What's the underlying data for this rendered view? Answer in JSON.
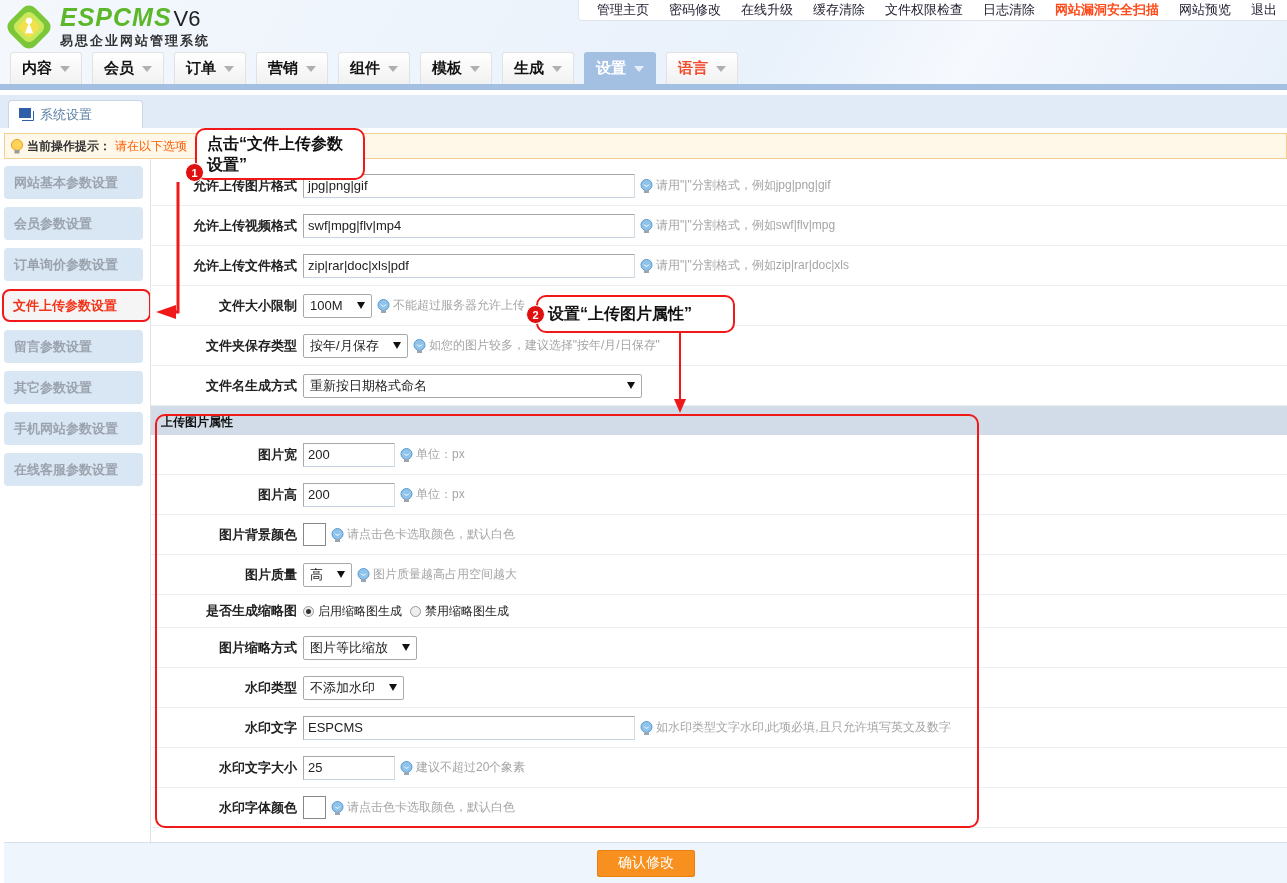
{
  "logo": {
    "brand": "ESPCMS",
    "version": "V6",
    "subtitle": "易思企业网站管理系统"
  },
  "top_links": [
    {
      "label": "管理主页",
      "highlighted": false
    },
    {
      "label": "密码修改",
      "highlighted": false
    },
    {
      "label": "在线升级",
      "highlighted": false
    },
    {
      "label": "缓存清除",
      "highlighted": false
    },
    {
      "label": "文件权限检查",
      "highlighted": false
    },
    {
      "label": "日志清除",
      "highlighted": false
    },
    {
      "label": "网站漏洞安全扫描",
      "highlighted": true
    },
    {
      "label": "网站预览",
      "highlighted": false
    },
    {
      "label": "退出",
      "highlighted": false
    }
  ],
  "main_menu": [
    {
      "label": "内容",
      "selected": false,
      "highlighted": false
    },
    {
      "label": "会员",
      "selected": false,
      "highlighted": false
    },
    {
      "label": "订单",
      "selected": false,
      "highlighted": false
    },
    {
      "label": "营销",
      "selected": false,
      "highlighted": false
    },
    {
      "label": "组件",
      "selected": false,
      "highlighted": false
    },
    {
      "label": "模板",
      "selected": false,
      "highlighted": false
    },
    {
      "label": "生成",
      "selected": false,
      "highlighted": false
    },
    {
      "label": "设置",
      "selected": true,
      "highlighted": false
    },
    {
      "label": "语言",
      "selected": false,
      "highlighted": true
    }
  ],
  "page_tab": {
    "label": "系统设置"
  },
  "tip": {
    "title": "当前操作提示：",
    "text": "请在以下选项"
  },
  "sidebar": {
    "items": [
      {
        "label": "网站基本参数设置",
        "selected": false
      },
      {
        "label": "会员参数设置",
        "selected": false
      },
      {
        "label": "订单询价参数设置",
        "selected": false
      },
      {
        "label": "文件上传参数设置",
        "selected": true
      },
      {
        "label": "留言参数设置",
        "selected": false
      },
      {
        "label": "其它参数设置",
        "selected": false
      },
      {
        "label": "手机网站参数设置",
        "selected": false
      },
      {
        "label": "在线客服参数设置",
        "selected": false
      }
    ]
  },
  "form": {
    "rows": [
      {
        "label": "允许上传图片格式",
        "kind": "text",
        "value": "jpg|png|gif",
        "hint": "请用\"|\"分割格式，例如jpg|png|gif"
      },
      {
        "label": "允许上传视频格式",
        "kind": "text",
        "value": "swf|mpg|flv|mp4",
        "hint": "请用\"|\"分割格式，例如swf|flv|mpg"
      },
      {
        "label": "允许上传文件格式",
        "kind": "text",
        "value": "zip|rar|doc|xls|pdf",
        "hint": "请用\"|\"分割格式，例如zip|rar|doc|xls"
      },
      {
        "label": "文件大小限制",
        "kind": "select",
        "value": "100M",
        "hint": "不能超过服务器允许上传"
      },
      {
        "label": "文件夹保存类型",
        "kind": "select",
        "value": "按年/月保存",
        "hint": "如您的图片较多，建议选择\"按年/月/日保存\""
      },
      {
        "label": "文件名生成方式",
        "kind": "wide-select",
        "value": "重新按日期格式命名"
      }
    ],
    "section": {
      "title": "上传图片属性",
      "rows": [
        {
          "label": "图片宽",
          "kind": "number",
          "value": "200",
          "hint": "单位：px"
        },
        {
          "label": "图片高",
          "kind": "number",
          "value": "200",
          "hint": "单位：px"
        },
        {
          "label": "图片背景颜色",
          "kind": "color",
          "hint": "请点击色卡选取颜色，默认白色"
        },
        {
          "label": "图片质量",
          "kind": "select",
          "value": "高",
          "hint": "图片质量越高占用空间越大"
        },
        {
          "label": "是否生成缩略图",
          "kind": "radio",
          "options": [
            {
              "label": "启用缩略图生成",
              "selected": true
            },
            {
              "label": "禁用缩略图生成",
              "selected": false
            }
          ]
        },
        {
          "label": "图片缩略方式",
          "kind": "select",
          "value": "图片等比缩放"
        },
        {
          "label": "水印类型",
          "kind": "select",
          "value": "不添加水印"
        },
        {
          "label": "水印文字",
          "kind": "text",
          "value": "ESPCMS",
          "hint": "如水印类型文字水印,此项必填,且只允许填写英文及数字"
        },
        {
          "label": "水印文字大小",
          "kind": "number",
          "value": "25",
          "hint": "建议不超过20个象素"
        },
        {
          "label": "水印字体颜色",
          "kind": "color",
          "hint": "请点击色卡选取颜色，默认白色"
        }
      ]
    }
  },
  "submit_button": "确认修改",
  "annotations": [
    {
      "number": "1",
      "text": "点击“文件上传参数设置”"
    },
    {
      "number": "2",
      "text": "设置“上传图片属性”"
    }
  ]
}
